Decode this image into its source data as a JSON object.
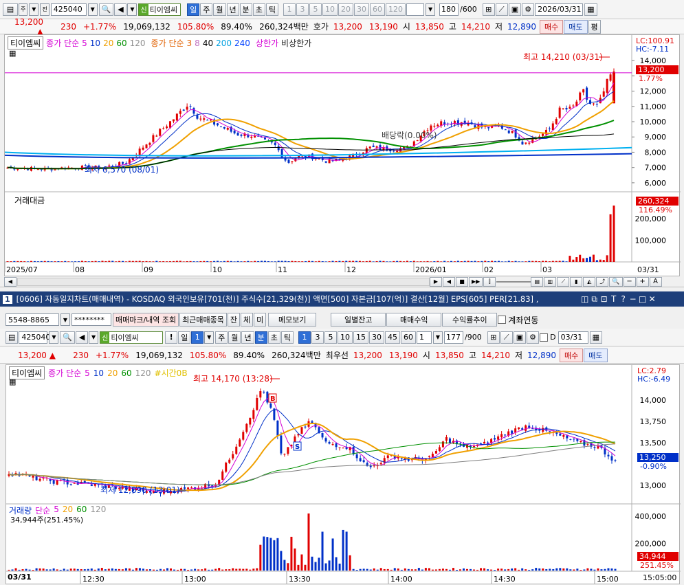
{
  "top": {
    "code": "425040",
    "stock_name": "티이엠씨",
    "tag": "신",
    "mode_left": "주",
    "mode_right": "전",
    "periods": [
      "일",
      "주",
      "월",
      "년",
      "분",
      "초",
      "틱"
    ],
    "nums": [
      "1",
      "3",
      "5",
      "10",
      "20",
      "30",
      "60",
      "120"
    ],
    "count": "180",
    "count_total": "/600",
    "date": "2026/03/31"
  },
  "quote_top": {
    "price": "13,200",
    "arrow": "▲",
    "change": "230",
    "pct": "+1.77%",
    "volume": "19,069,132",
    "vol_ratio": "105.80%",
    "turn": "89.40%",
    "amount": "260,324백만",
    "ask_label": "호가",
    "ask": "13,200",
    "bid": "13,190",
    "open_label": "시",
    "open": "13,850",
    "high_label": "고",
    "high": "14,210",
    "low_label": "저",
    "low": "12,890",
    "buy": "매수",
    "sell": "매도",
    "eval": "평"
  },
  "daily_chart": {
    "legend_name": "티이엠씨",
    "legend_ma1": "종가 단순",
    "ma1_periods": [
      "5",
      "10",
      "20",
      "60",
      "120"
    ],
    "legend_ma2": "종가 단순",
    "ma2_periods": [
      "3",
      "8",
      "40",
      "200",
      "240"
    ],
    "legend_upper": "상한가",
    "legend_lower": "비상한가",
    "lc": "LC:100.91",
    "hc": "HC:-7.11",
    "price_tag": "13,200",
    "price_pct": "1.77%",
    "high_note": "최고 14,210 (03/31)",
    "low_note": "최저 6,570 (08/01)",
    "div_note": "배당락(0.00%)",
    "y_ticks": [
      "14,000",
      "13,000",
      "12,000",
      "11,000",
      "10,000",
      "9,000",
      "8,000",
      "7,000",
      "6,000"
    ],
    "vol_title": "거래대금",
    "vol_tag": "260,324",
    "vol_pct": "116.49%",
    "vol_ticks": [
      "200,000",
      "100,000"
    ],
    "x_ticks": [
      "2025/07",
      "08",
      "09",
      "10",
      "11",
      "12",
      "2026/01",
      "02",
      "03"
    ],
    "x_end": "03/31"
  },
  "win2": {
    "title": "[0606] 자동일지차트(매매내역) - KOSDAQ 외국인보유[701(천)] 주식수[21,329(천)] 액면[500] 자본금[107(억)] 결산[12월] EPS[605] PER[21.83] ,",
    "num": "1",
    "account": "5548-8865",
    "password": "********",
    "btn_mark": "매매마크/내역 조회",
    "btn_recent": "최근매매종목",
    "btn_jan": "잔",
    "btn_che": "체",
    "btn_mi": "미",
    "btn_memo": "메모보기",
    "btn_daily": "일별잔고",
    "btn_profit": "매매수익",
    "btn_rate": "수익률추이",
    "chk_link": "계좌연동",
    "code": "425040",
    "stock_name": "티이엠씨",
    "tag": "신",
    "period_sel": "1",
    "periods": [
      "일",
      "주",
      "월",
      "년",
      "분",
      "초",
      "틱"
    ],
    "nums": [
      "1",
      "3",
      "5",
      "10",
      "15",
      "30",
      "45",
      "60"
    ],
    "sel2": "1",
    "count": "177",
    "count_total": "/900",
    "d_label": "D",
    "date": "03/31"
  },
  "quote_bottom": {
    "price": "13,200",
    "arrow": "▲",
    "change": "230",
    "pct": "+1.77%",
    "volume": "19,069,132",
    "vol_ratio": "105.80%",
    "turn": "89.40%",
    "amount": "260,324백만",
    "best_label": "최우선",
    "ask": "13,200",
    "bid": "13,190",
    "open_label": "시",
    "open": "13,850",
    "high_label": "고",
    "high": "14,210",
    "low_label": "저",
    "low": "12,890",
    "buy": "매수",
    "sell": "매도"
  },
  "minute_chart": {
    "legend_name": "티이엠씨",
    "legend_ma": "종가 단순",
    "ma_periods": [
      "5",
      "10",
      "20",
      "60",
      "120"
    ],
    "legend_time": "#시간0B",
    "lc": "LC:2.79",
    "hc": "HC:-6.49",
    "price_tag": "13,250",
    "price_pct": "-0.90%",
    "high_note": "최고 14,170 (13:28)",
    "low_note": "최저 12,890 (13:01)",
    "y_ticks": [
      "14,000",
      "13,750",
      "13,500",
      "13,000"
    ],
    "vol_title": "거래량",
    "vol_ma": "단순",
    "vol_periods": [
      "5",
      "20",
      "60",
      "120"
    ],
    "vol_note": "34,944주(251.45%)",
    "vol_tag": "34,944",
    "vol_pct": "251.45%",
    "vol_ticks": [
      "400,000",
      "200,000"
    ],
    "x_start": "03/31",
    "x_ticks": [
      "12:30",
      "13:00",
      "13:30",
      "14:00",
      "14:30",
      "15:00"
    ],
    "x_end": "15:05:00",
    "mark_b": "B",
    "mark_s": "S"
  },
  "colors": {
    "up": "#e00000",
    "down": "#0030c8",
    "ma5": "#d400d4",
    "ma20": "#f0a000",
    "ma60": "#009000",
    "ma120": "#000000"
  }
}
